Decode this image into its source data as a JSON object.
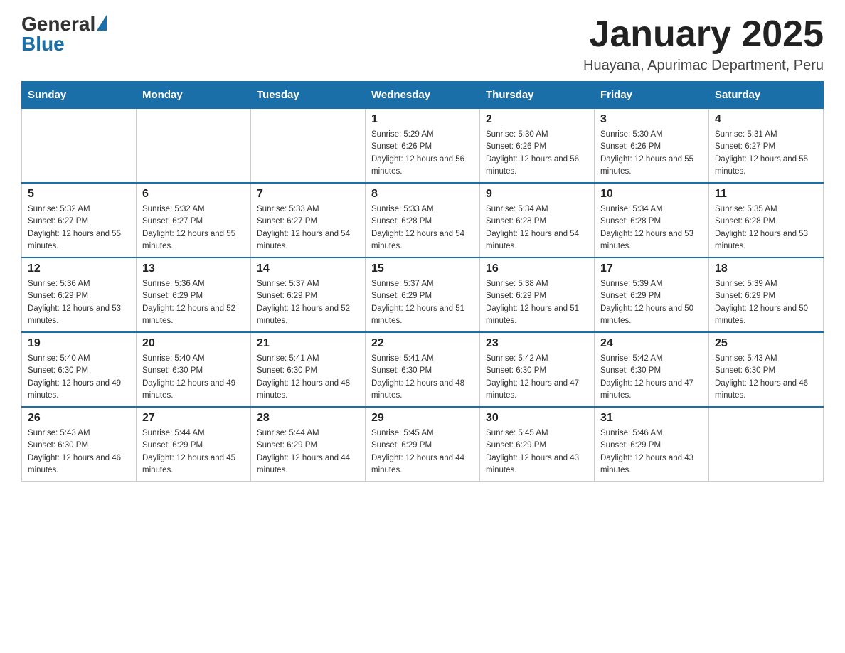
{
  "logo": {
    "general": "General",
    "blue": "Blue"
  },
  "header": {
    "title": "January 2025",
    "subtitle": "Huayana, Apurimac Department, Peru"
  },
  "weekdays": [
    "Sunday",
    "Monday",
    "Tuesday",
    "Wednesday",
    "Thursday",
    "Friday",
    "Saturday"
  ],
  "weeks": [
    [
      {
        "day": "",
        "info": ""
      },
      {
        "day": "",
        "info": ""
      },
      {
        "day": "",
        "info": ""
      },
      {
        "day": "1",
        "info": "Sunrise: 5:29 AM\nSunset: 6:26 PM\nDaylight: 12 hours and 56 minutes."
      },
      {
        "day": "2",
        "info": "Sunrise: 5:30 AM\nSunset: 6:26 PM\nDaylight: 12 hours and 56 minutes."
      },
      {
        "day": "3",
        "info": "Sunrise: 5:30 AM\nSunset: 6:26 PM\nDaylight: 12 hours and 55 minutes."
      },
      {
        "day": "4",
        "info": "Sunrise: 5:31 AM\nSunset: 6:27 PM\nDaylight: 12 hours and 55 minutes."
      }
    ],
    [
      {
        "day": "5",
        "info": "Sunrise: 5:32 AM\nSunset: 6:27 PM\nDaylight: 12 hours and 55 minutes."
      },
      {
        "day": "6",
        "info": "Sunrise: 5:32 AM\nSunset: 6:27 PM\nDaylight: 12 hours and 55 minutes."
      },
      {
        "day": "7",
        "info": "Sunrise: 5:33 AM\nSunset: 6:27 PM\nDaylight: 12 hours and 54 minutes."
      },
      {
        "day": "8",
        "info": "Sunrise: 5:33 AM\nSunset: 6:28 PM\nDaylight: 12 hours and 54 minutes."
      },
      {
        "day": "9",
        "info": "Sunrise: 5:34 AM\nSunset: 6:28 PM\nDaylight: 12 hours and 54 minutes."
      },
      {
        "day": "10",
        "info": "Sunrise: 5:34 AM\nSunset: 6:28 PM\nDaylight: 12 hours and 53 minutes."
      },
      {
        "day": "11",
        "info": "Sunrise: 5:35 AM\nSunset: 6:28 PM\nDaylight: 12 hours and 53 minutes."
      }
    ],
    [
      {
        "day": "12",
        "info": "Sunrise: 5:36 AM\nSunset: 6:29 PM\nDaylight: 12 hours and 53 minutes."
      },
      {
        "day": "13",
        "info": "Sunrise: 5:36 AM\nSunset: 6:29 PM\nDaylight: 12 hours and 52 minutes."
      },
      {
        "day": "14",
        "info": "Sunrise: 5:37 AM\nSunset: 6:29 PM\nDaylight: 12 hours and 52 minutes."
      },
      {
        "day": "15",
        "info": "Sunrise: 5:37 AM\nSunset: 6:29 PM\nDaylight: 12 hours and 51 minutes."
      },
      {
        "day": "16",
        "info": "Sunrise: 5:38 AM\nSunset: 6:29 PM\nDaylight: 12 hours and 51 minutes."
      },
      {
        "day": "17",
        "info": "Sunrise: 5:39 AM\nSunset: 6:29 PM\nDaylight: 12 hours and 50 minutes."
      },
      {
        "day": "18",
        "info": "Sunrise: 5:39 AM\nSunset: 6:29 PM\nDaylight: 12 hours and 50 minutes."
      }
    ],
    [
      {
        "day": "19",
        "info": "Sunrise: 5:40 AM\nSunset: 6:30 PM\nDaylight: 12 hours and 49 minutes."
      },
      {
        "day": "20",
        "info": "Sunrise: 5:40 AM\nSunset: 6:30 PM\nDaylight: 12 hours and 49 minutes."
      },
      {
        "day": "21",
        "info": "Sunrise: 5:41 AM\nSunset: 6:30 PM\nDaylight: 12 hours and 48 minutes."
      },
      {
        "day": "22",
        "info": "Sunrise: 5:41 AM\nSunset: 6:30 PM\nDaylight: 12 hours and 48 minutes."
      },
      {
        "day": "23",
        "info": "Sunrise: 5:42 AM\nSunset: 6:30 PM\nDaylight: 12 hours and 47 minutes."
      },
      {
        "day": "24",
        "info": "Sunrise: 5:42 AM\nSunset: 6:30 PM\nDaylight: 12 hours and 47 minutes."
      },
      {
        "day": "25",
        "info": "Sunrise: 5:43 AM\nSunset: 6:30 PM\nDaylight: 12 hours and 46 minutes."
      }
    ],
    [
      {
        "day": "26",
        "info": "Sunrise: 5:43 AM\nSunset: 6:30 PM\nDaylight: 12 hours and 46 minutes."
      },
      {
        "day": "27",
        "info": "Sunrise: 5:44 AM\nSunset: 6:29 PM\nDaylight: 12 hours and 45 minutes."
      },
      {
        "day": "28",
        "info": "Sunrise: 5:44 AM\nSunset: 6:29 PM\nDaylight: 12 hours and 44 minutes."
      },
      {
        "day": "29",
        "info": "Sunrise: 5:45 AM\nSunset: 6:29 PM\nDaylight: 12 hours and 44 minutes."
      },
      {
        "day": "30",
        "info": "Sunrise: 5:45 AM\nSunset: 6:29 PM\nDaylight: 12 hours and 43 minutes."
      },
      {
        "day": "31",
        "info": "Sunrise: 5:46 AM\nSunset: 6:29 PM\nDaylight: 12 hours and 43 minutes."
      },
      {
        "day": "",
        "info": ""
      }
    ]
  ]
}
